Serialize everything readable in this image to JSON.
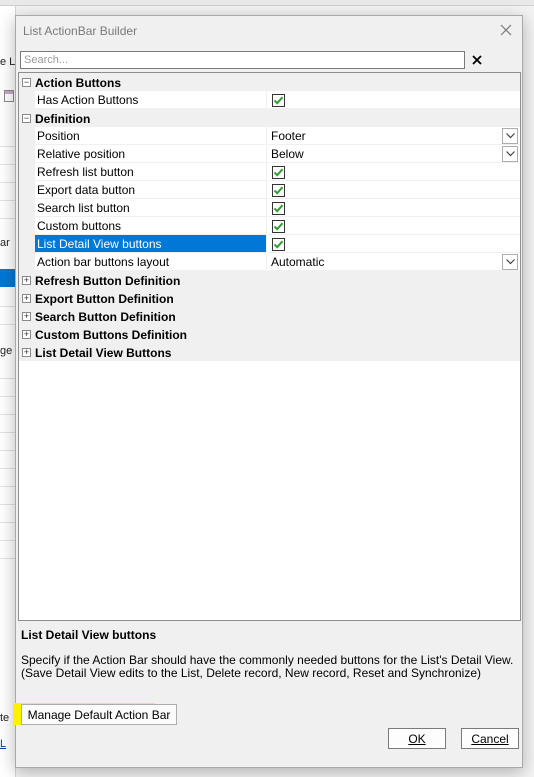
{
  "background": {
    "fragments": [
      "e Li",
      "ar",
      "ge",
      "te I"
    ]
  },
  "dialog": {
    "title": "List ActionBar Builder",
    "search_placeholder": "Search...",
    "grid": {
      "categories": {
        "action_buttons": "Action Buttons",
        "definition": "Definition",
        "refresh": "Refresh Button Definition",
        "export": "Export Button Definition",
        "search": "Search Button Definition",
        "custom": "Custom Buttons Definition",
        "list_detail": "List Detail View Buttons"
      },
      "props": {
        "has_action_buttons": "Has Action Buttons",
        "position": "Position",
        "position_value": "Footer",
        "relative_position": "Relative position",
        "relative_position_value": "Below",
        "refresh_list_button": "Refresh list button",
        "export_data_button": "Export data button",
        "search_list_button": "Search list button",
        "custom_buttons": "Custom buttons",
        "list_detail_view_buttons": "List Detail View buttons",
        "action_bar_buttons_layout": "Action bar buttons layout",
        "action_bar_buttons_layout_value": "Automatic"
      }
    },
    "description": {
      "title": "List Detail View buttons",
      "text": "Specify if the Action Bar should have the commonly needed buttons for the List's Detail View. (Save Detail View edits to the List, Delete record, New record, Reset and Synchronize)"
    },
    "buttons": {
      "manage_default": "Manage Default Action Bar",
      "ok": "OK",
      "cancel": "Cancel"
    }
  },
  "colors": {
    "selection": "#0078d7",
    "highlight": "#fff200",
    "checkmark": "#2e9e2e"
  }
}
